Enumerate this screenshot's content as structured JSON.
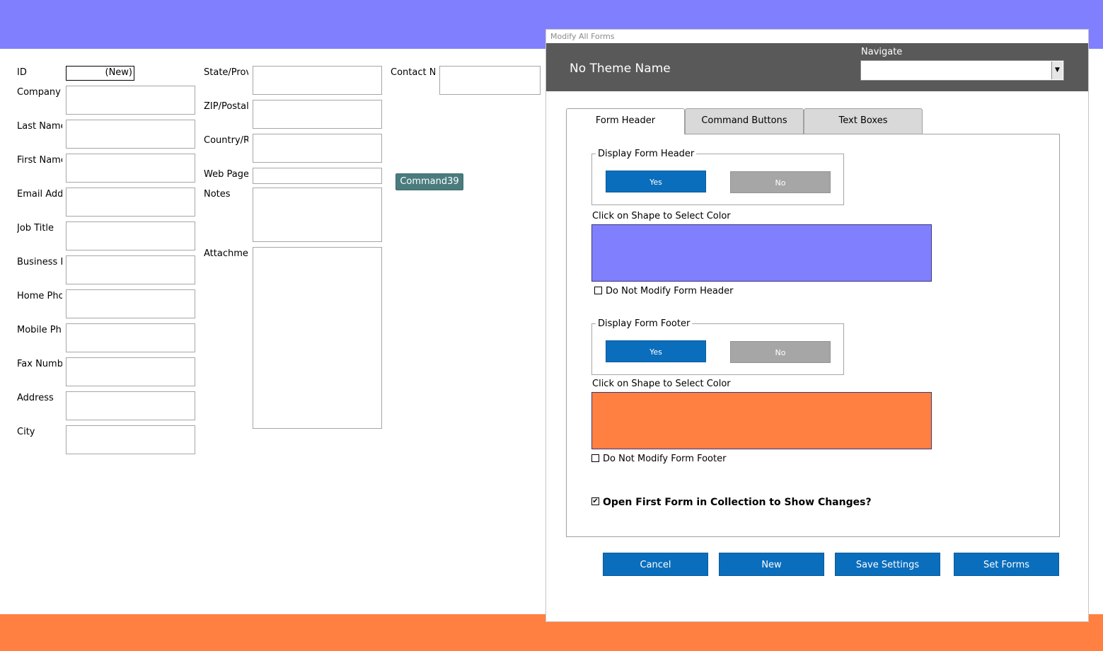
{
  "form": {
    "fields_left": [
      {
        "label": "ID",
        "value": "(New)"
      },
      {
        "label": "Company",
        "value": ""
      },
      {
        "label": "Last Name",
        "value": ""
      },
      {
        "label": "First Name",
        "value": ""
      },
      {
        "label": "Email Add",
        "value": ""
      },
      {
        "label": "Job Title",
        "value": ""
      },
      {
        "label": "Business P",
        "value": ""
      },
      {
        "label": "Home Pho",
        "value": ""
      },
      {
        "label": "Mobile Ph",
        "value": ""
      },
      {
        "label": "Fax Numb",
        "value": ""
      },
      {
        "label": "Address",
        "value": ""
      },
      {
        "label": "City",
        "value": ""
      }
    ],
    "fields_middle": [
      {
        "label": "State/Prov"
      },
      {
        "label": "ZIP/Postal"
      },
      {
        "label": "Country/R"
      },
      {
        "label": "Web Page"
      },
      {
        "label": "Notes"
      },
      {
        "label": "Attachmer"
      }
    ],
    "contact_label": "Contact Na",
    "command_button": "Command39",
    "colors": {
      "header": "#8080ff",
      "footer": "#ff8040"
    }
  },
  "dialog": {
    "title": "Modify All Forms",
    "theme_name": "No Theme Name",
    "navigate_label": "Navigate",
    "navigate_value": "",
    "tabs": [
      {
        "label": "Form Header",
        "active": true
      },
      {
        "label": "Command Buttons",
        "active": false
      },
      {
        "label": "Text Boxes",
        "active": false
      }
    ],
    "header_section": {
      "group_label": "Display Form Header",
      "yes_label": "Yes",
      "no_label": "No",
      "color_prompt": "Click on Shape to Select Color",
      "color": "#8080ff",
      "checkbox_label": "Do Not Modify Form Header",
      "checked": false
    },
    "footer_section": {
      "group_label": "Display Form Footer",
      "yes_label": "Yes",
      "no_label": "No",
      "color_prompt": "Click on Shape to Select Color",
      "color": "#ff8040",
      "checkbox_label": "Do Not Modify Form Footer",
      "checked": false
    },
    "open_first_form": {
      "label": "Open First Form in Collection to Show Changes?",
      "checked": true
    },
    "buttons": {
      "cancel": "Cancel",
      "new": "New",
      "save": "Save Settings",
      "set": "Set Forms"
    }
  }
}
